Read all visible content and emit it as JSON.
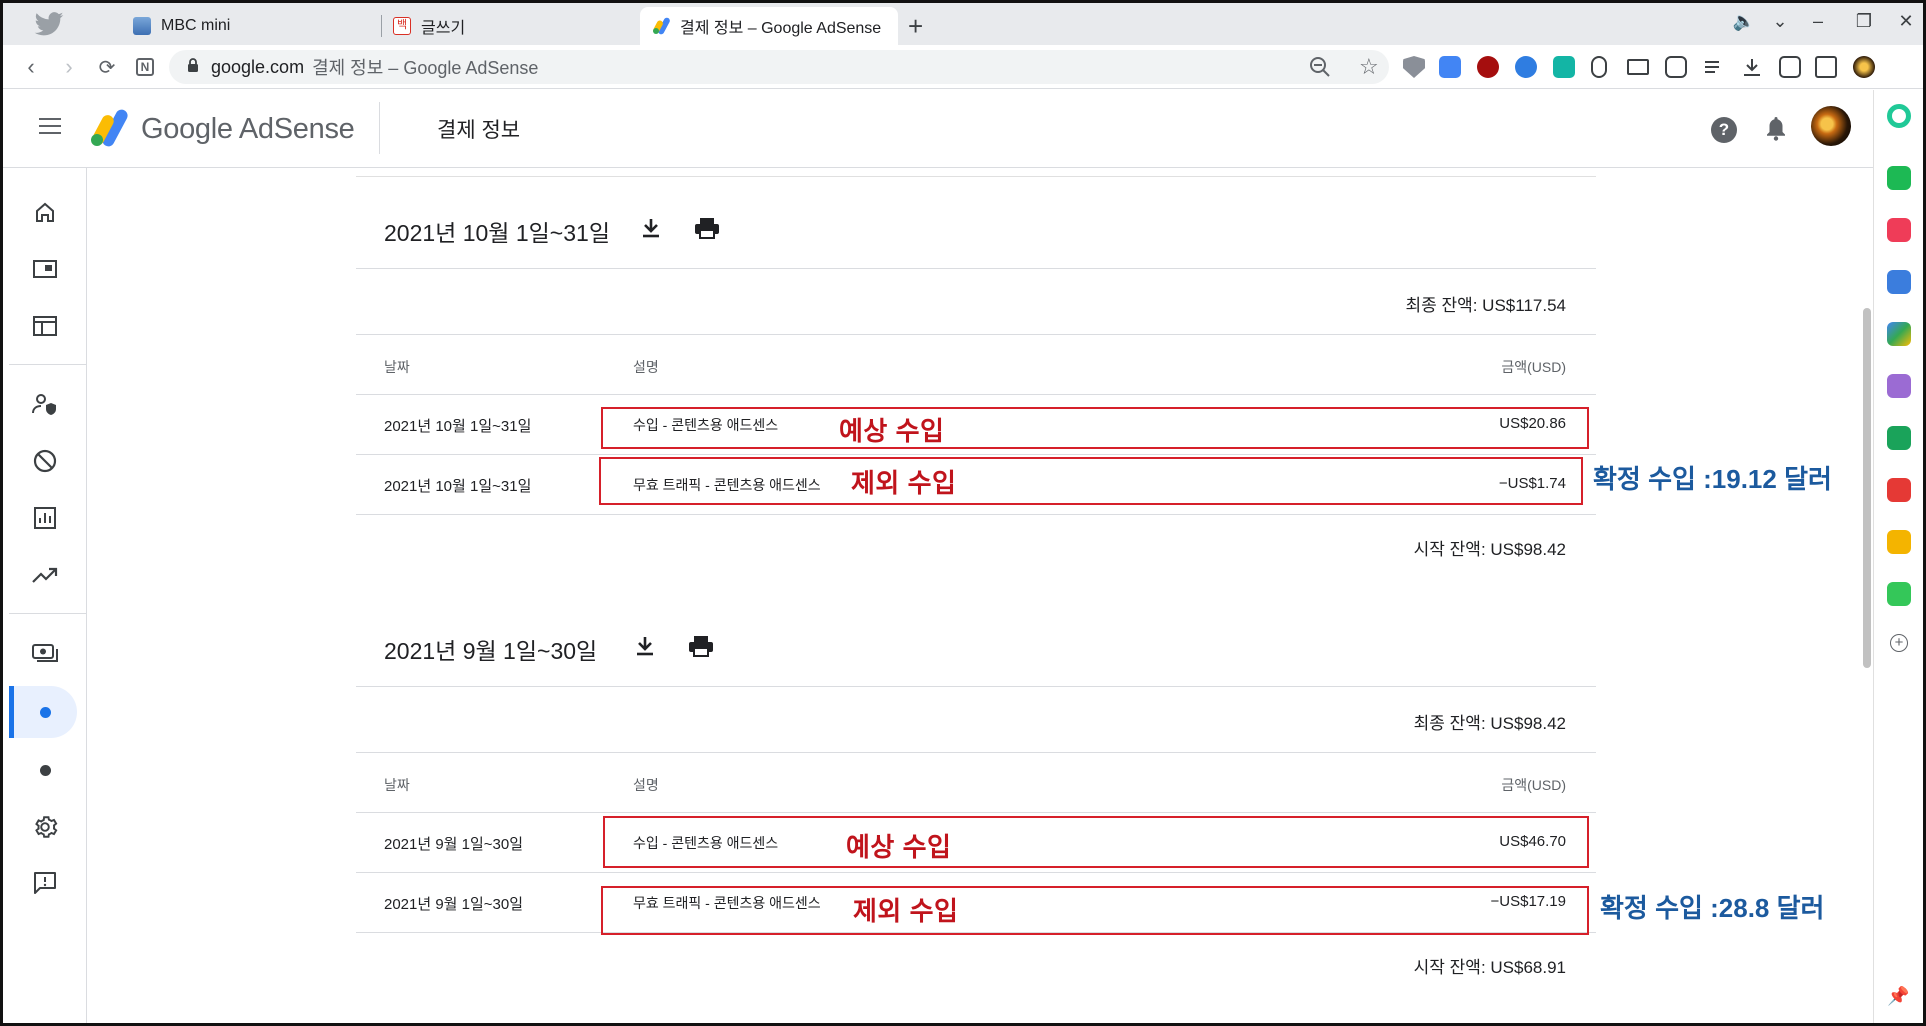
{
  "browser": {
    "tabs": [
      {
        "label": "MBC mini"
      },
      {
        "label": "글쓰기"
      },
      {
        "label": "결제 정보 – Google AdSense"
      }
    ],
    "address": {
      "host": "google.com",
      "page_title": "결제 정보 – Google AdSense"
    }
  },
  "header": {
    "brand": "Google AdSense",
    "page_title": "결제 정보"
  },
  "sections": [
    {
      "period": "2021년 10월 1일~31일",
      "final_balance": "최종 잔액: US$117.54",
      "columns": {
        "date": "날짜",
        "description": "설명",
        "amount": "금액(USD)"
      },
      "rows": [
        {
          "date": "2021년 10월 1일~31일",
          "description": "수입 - 콘텐츠용 애드센스",
          "amount": "US$20.86"
        },
        {
          "date": "2021년 10월 1일~31일",
          "description": "무효 트래픽 - 콘텐츠용 애드센스",
          "amount": "−US$1.74"
        }
      ],
      "start_balance": "시작 잔액: US$98.42"
    },
    {
      "period": "2021년 9월 1일~30일",
      "final_balance": "최종 잔액: US$98.42",
      "columns": {
        "date": "날짜",
        "description": "설명",
        "amount": "금액(USD)"
      },
      "rows": [
        {
          "date": "2021년 9월 1일~30일",
          "description": "수입 - 콘텐츠용 애드센스",
          "amount": "US$46.70"
        },
        {
          "date": "2021년 9월 1일~30일",
          "description": "무효 트래픽 - 콘텐츠용 애드센스",
          "amount": "−US$17.19"
        }
      ],
      "start_balance": "시작 잔액: US$68.91"
    }
  ],
  "annotations": {
    "expected": "예상 수입",
    "excluded": "제외 수입",
    "confirmed_oct": "확정 수입 :19.12 달러",
    "confirmed_sep": "확정 수입 :28.8 달러"
  },
  "colors": {
    "accent": "#1a73e8",
    "annotation_red": "#c0141c",
    "annotation_blue": "#1c5a9e"
  }
}
